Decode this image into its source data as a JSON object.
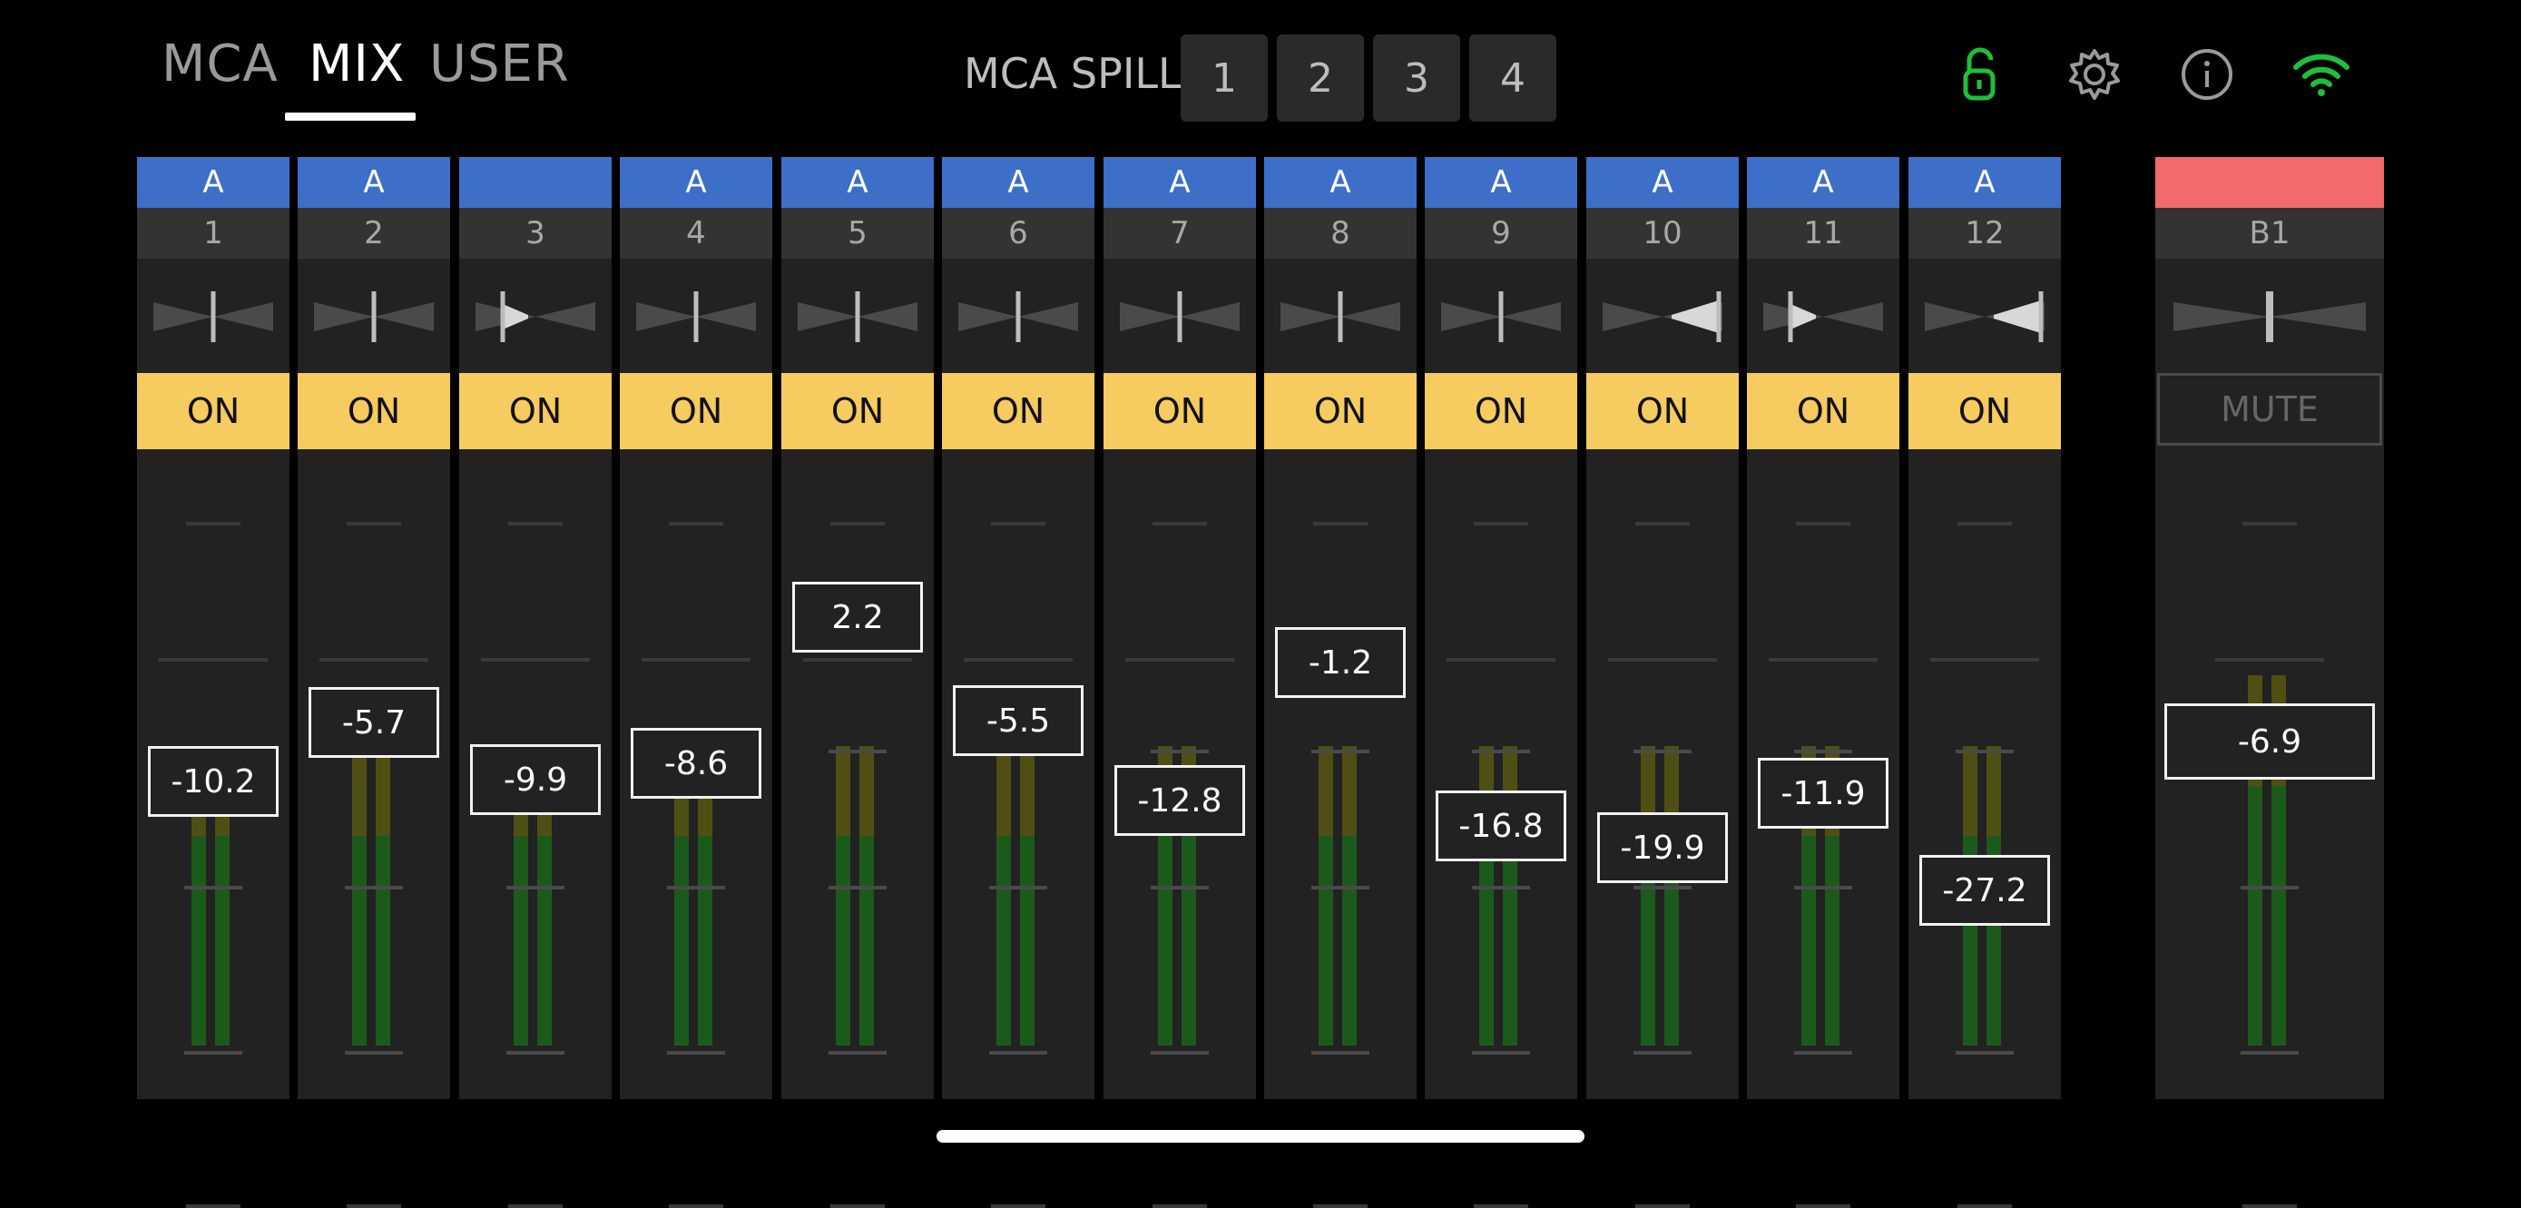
{
  "tabs": [
    {
      "label": "MCA",
      "active": false
    },
    {
      "label": "MIX",
      "active": true
    },
    {
      "label": "USER",
      "active": false
    }
  ],
  "spill": {
    "label": "MCA SPILL",
    "buttons": [
      "1",
      "2",
      "3",
      "4"
    ]
  },
  "top_icons": [
    "unlock-icon",
    "gear-icon",
    "info-icon",
    "wifi-icon"
  ],
  "colors": {
    "accent_blue": "#3d6fc9",
    "on_yellow": "#f6cb5f",
    "bus_red": "#f26a6a",
    "status_green": "#1fbf3a"
  },
  "channels": [
    {
      "group": "A",
      "number": "1",
      "state": "ON",
      "level": "-10.2",
      "pan": "center"
    },
    {
      "group": "A",
      "number": "2",
      "state": "ON",
      "level": "-5.7",
      "pan": "center"
    },
    {
      "group": "",
      "number": "3",
      "state": "ON",
      "level": "-9.9",
      "pan": "left"
    },
    {
      "group": "A",
      "number": "4",
      "state": "ON",
      "level": "-8.6",
      "pan": "center"
    },
    {
      "group": "A",
      "number": "5",
      "state": "ON",
      "level": "2.2",
      "pan": "center"
    },
    {
      "group": "A",
      "number": "6",
      "state": "ON",
      "level": "-5.5",
      "pan": "center"
    },
    {
      "group": "A",
      "number": "7",
      "state": "ON",
      "level": "-12.8",
      "pan": "center"
    },
    {
      "group": "A",
      "number": "8",
      "state": "ON",
      "level": "-1.2",
      "pan": "center"
    },
    {
      "group": "A",
      "number": "9",
      "state": "ON",
      "level": "-16.8",
      "pan": "center"
    },
    {
      "group": "A",
      "number": "10",
      "state": "ON",
      "level": "-19.9",
      "pan": "right"
    },
    {
      "group": "A",
      "number": "11",
      "state": "ON",
      "level": "-11.9",
      "pan": "left"
    },
    {
      "group": "A",
      "number": "12",
      "state": "ON",
      "level": "-27.2",
      "pan": "right"
    }
  ],
  "bus": {
    "number": "B1",
    "state": "MUTE",
    "level": "-6.9",
    "pan": "center"
  }
}
